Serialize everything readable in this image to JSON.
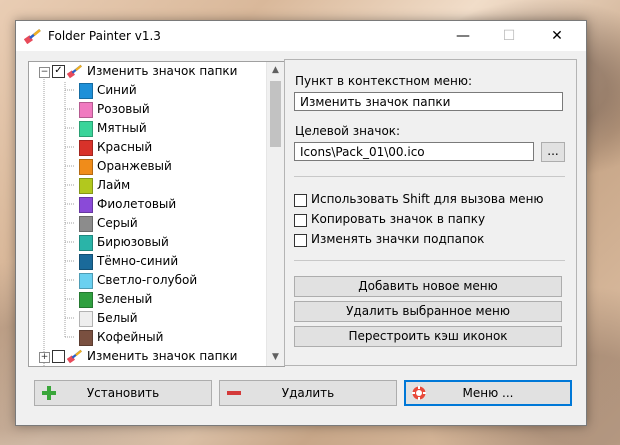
{
  "window": {
    "title": "Folder Painter v1.3"
  },
  "tree": {
    "root_label": "Изменить значок папки",
    "items": [
      {
        "label": "Синий",
        "color": "#1e90d8"
      },
      {
        "label": "Розовый",
        "color": "#f07ac0"
      },
      {
        "label": "Мятный",
        "color": "#3ad49a"
      },
      {
        "label": "Красный",
        "color": "#d8322a"
      },
      {
        "label": "Оранжевый",
        "color": "#f08c1a"
      },
      {
        "label": "Лайм",
        "color": "#b2c81e"
      },
      {
        "label": "Фиолетовый",
        "color": "#8a4ad8"
      },
      {
        "label": "Серый",
        "color": "#8c8c8c"
      },
      {
        "label": "Бирюзовый",
        "color": "#2ab4a8"
      },
      {
        "label": "Тёмно-синий",
        "color": "#1a6a9a"
      },
      {
        "label": "Светло-голубой",
        "color": "#6ad0f0"
      },
      {
        "label": "Зеленый",
        "color": "#30a040"
      },
      {
        "label": "Белый",
        "color": "#eeeeee"
      },
      {
        "label": "Кофейный",
        "color": "#7a5040"
      }
    ],
    "second_root_label": "Изменить значок папки"
  },
  "panel": {
    "menu_item_label": "Пункт в контекстном меню:",
    "menu_item_value": "Изменить значок папки",
    "target_icon_label": "Целевой значок:",
    "target_icon_value": "Icons\\Pack_01\\00.ico",
    "browse_label": "...",
    "checkboxes": [
      {
        "label": "Использовать Shift для вызова меню",
        "checked": false
      },
      {
        "label": "Копировать значок в папку",
        "checked": false
      },
      {
        "label": "Изменять значки подпапок",
        "checked": false
      }
    ],
    "add_menu_button": "Добавить новое меню",
    "delete_menu_button": "Удалить выбранное меню",
    "rebuild_cache_button": "Перестроить кэш иконок"
  },
  "bottom": {
    "install_button": "Установить",
    "remove_button": "Удалить",
    "menu_button": "Меню ..."
  },
  "colors": {
    "accent": "#0078d7",
    "plus": "#3aa63a",
    "minus": "#d43a3a"
  }
}
